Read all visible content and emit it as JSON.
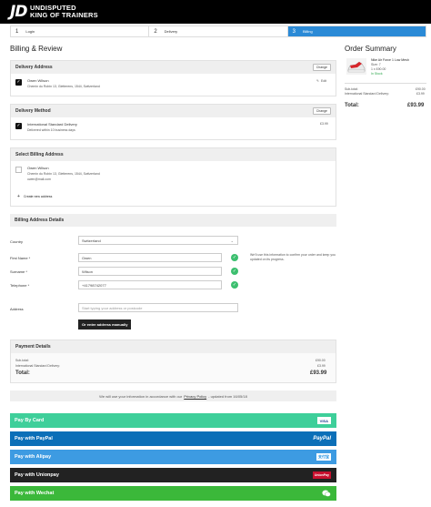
{
  "brand": {
    "logo_mark": "JD",
    "line1": "UNDISPUTED",
    "line2": "KING OF TRAINERS"
  },
  "steps": [
    {
      "num": "1",
      "label": "Login"
    },
    {
      "num": "2",
      "label": "Delivery"
    },
    {
      "num": "3",
      "label": "Billing"
    }
  ],
  "page_title": "Billing & Review",
  "order_summary": {
    "title": "Order Summary",
    "item": {
      "name": "Nike Air Force 1 Low Mesh",
      "size": "Size: 7",
      "qty_price": "1 x £90.00",
      "stock": "In Stock"
    },
    "subtotal_label": "Sub-total:",
    "subtotal": "£90.00",
    "delivery_label": "International Standard Delivery:",
    "delivery": "£3.99",
    "total_label": "Total:",
    "total": "£93.99"
  },
  "delivery_address": {
    "title": "Delivery Address",
    "change": "Change",
    "name": "Owen Wilson",
    "address": "Chemin du Robin 13, Gletterens, 1544, Switzerland",
    "edit": "Edit"
  },
  "delivery_method": {
    "title": "Delivery Method",
    "change": "Change",
    "name": "International Standard Delivery",
    "note": "Delivered within 10 business days",
    "price": "£3.99"
  },
  "billing_select": {
    "title": "Select Billing Address",
    "name": "Owen Wilson",
    "address": "Chemin du Robin 13, Gletterens, 1544, Switzerland",
    "email": "owen@mail.com",
    "add_new": "Create new address"
  },
  "billing_details": {
    "title": "Billing Address Details",
    "country_label": "Country",
    "country_value": "Switzerland",
    "first_name_label": "First Name *",
    "first_name_value": "Owen",
    "surname_label": "Surname *",
    "surname_value": "Wilson",
    "telephone_label": "Telephone *",
    "telephone_value": "+41798742077",
    "phone_note": "We'll use this information to confirm your order and keep you updated on its progress.",
    "address_label": "Address",
    "address_placeholder": "Start typing your address or postcode",
    "manual_button": "Or enter address manually"
  },
  "payment_details": {
    "title": "Payment Details",
    "subtotal_label": "Sub-total:",
    "subtotal": "£90.00",
    "delivery_label": "International Standard Delivery:",
    "delivery": "£3.99",
    "total_label": "Total:",
    "total": "£93.99"
  },
  "notice": {
    "before": "We will use your information in accordance with our",
    "link": "Privacy Policy",
    "after": "- updated from 16/05/18"
  },
  "payments": [
    {
      "label": "Pay By Card",
      "color": "#3ecf9a",
      "icon": "VISA"
    },
    {
      "label": "Pay with PayPal",
      "color": "#0b6fb8",
      "icon": "PayPal"
    },
    {
      "label": "Pay with Alipay",
      "color": "#3d9be2",
      "icon": "支付宝"
    },
    {
      "label": "Pay with Unionpay",
      "color": "#222222",
      "icon": "UnionPay"
    },
    {
      "label": "Pay with Wechat",
      "color": "#3bb83a",
      "icon": "WeChat"
    }
  ]
}
